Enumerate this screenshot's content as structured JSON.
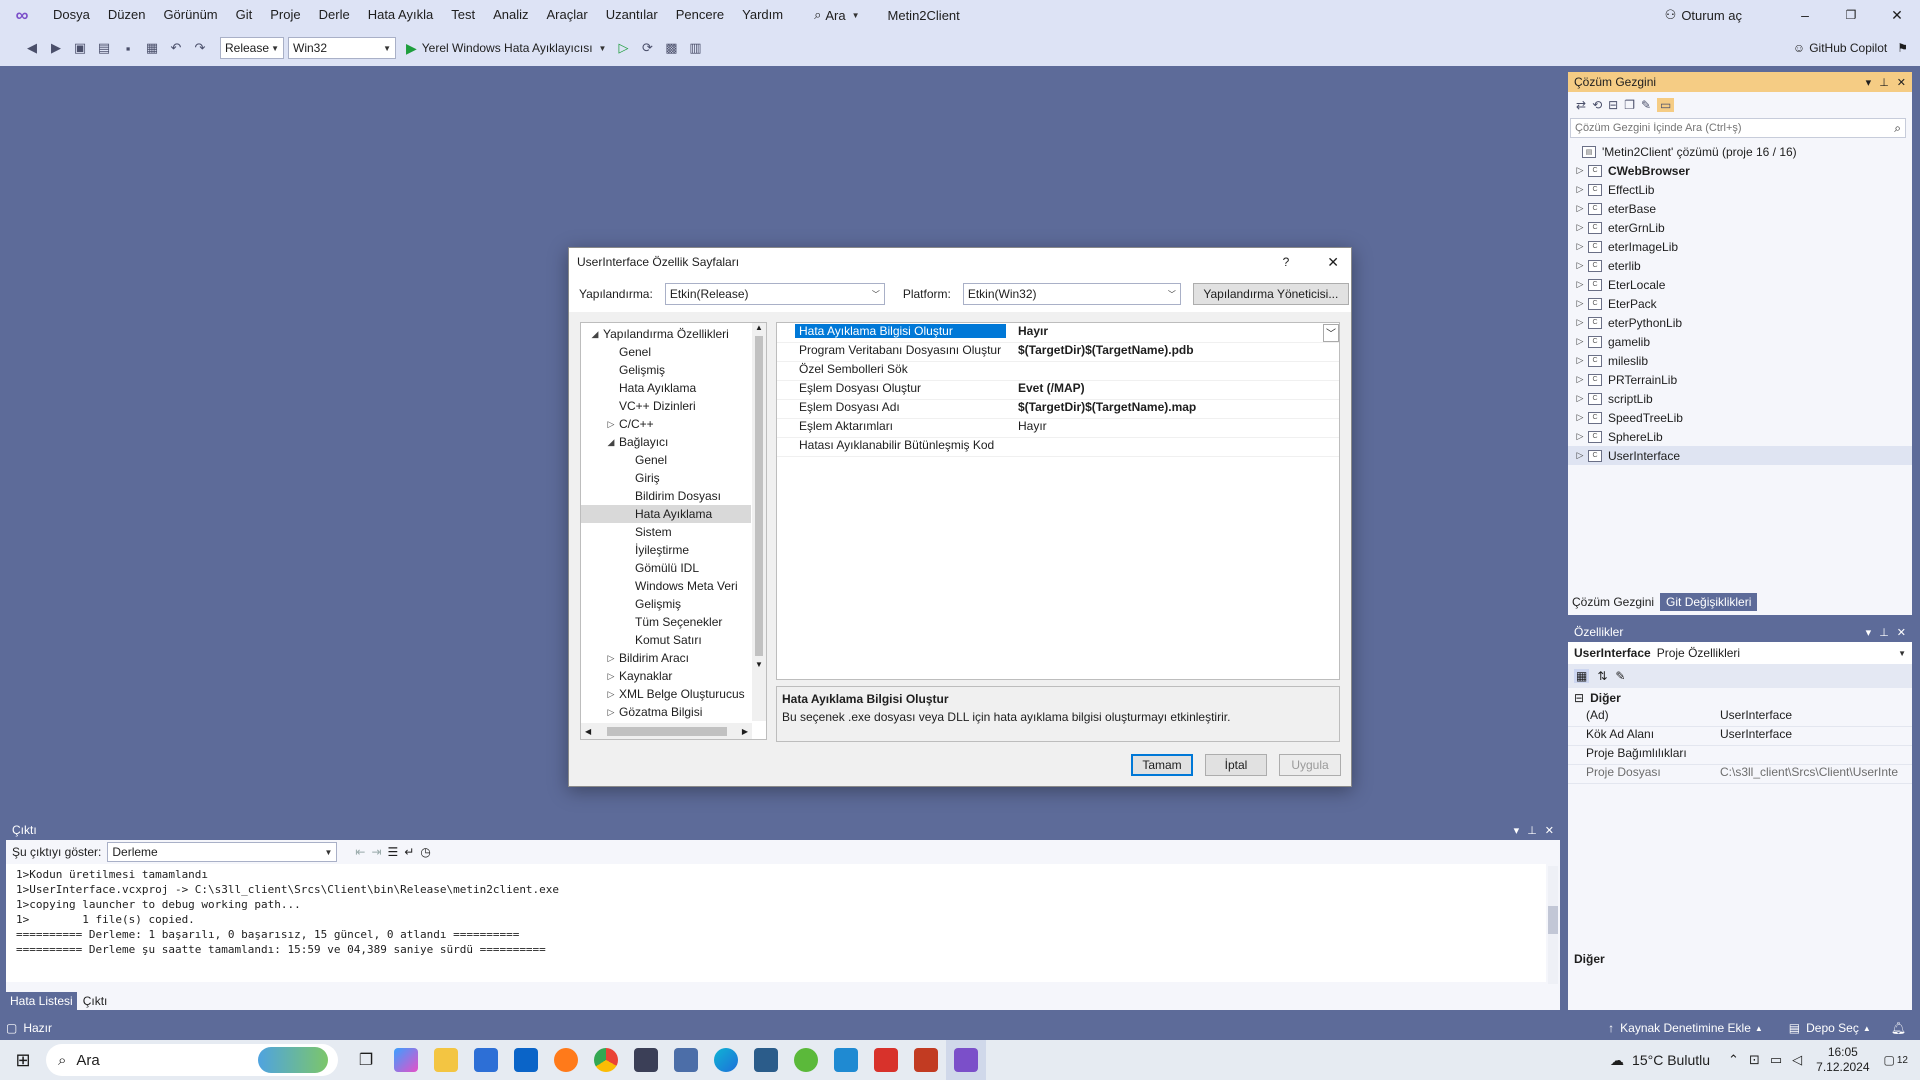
{
  "menu": {
    "items": [
      "Dosya",
      "Düzen",
      "Görünüm",
      "Git",
      "Proje",
      "Derle",
      "Hata Ayıkla",
      "Test",
      "Analiz",
      "Araçlar",
      "Uzantılar",
      "Pencere",
      "Yardım"
    ],
    "search": "Ara",
    "solution_name": "Metin2Client",
    "signin": "Oturum aç"
  },
  "toolbar": {
    "config": "Release",
    "platform": "Win32",
    "debug_label": "Yerel Windows Hata Ayıklayıcısı",
    "copilot": "GitHub Copilot"
  },
  "solution": {
    "title": "Çözüm Gezgini",
    "search_placeholder": "Çözüm Gezgini İçinde Ara (Ctrl+ş)",
    "root": "'Metin2Client' çözümü (proje 16 / 16)",
    "projects": [
      "CWebBrowser",
      "EffectLib",
      "eterBase",
      "eterGrnLib",
      "eterImageLib",
      "eterlib",
      "EterLocale",
      "EterPack",
      "eterPythonLib",
      "gamelib",
      "mileslib",
      "PRTerrainLib",
      "scriptLib",
      "SpeedTreeLib",
      "SphereLib",
      "UserInterface"
    ],
    "tab1": "Çözüm Gezgini",
    "tab2": "Git Değişiklikleri"
  },
  "properties": {
    "title": "Özellikler",
    "object": "UserInterface",
    "object_type": "Proje Özellikleri",
    "category": "Diğer",
    "rows": [
      {
        "k": "(Ad)",
        "v": "UserInterface"
      },
      {
        "k": "Kök Ad Alanı",
        "v": "UserInterface"
      },
      {
        "k": "Proje Bağımlılıkları",
        "v": ""
      },
      {
        "k": "Proje Dosyası",
        "v": "C:\\s3ll_client\\Srcs\\Client\\UserInte"
      }
    ],
    "footer": "Diğer"
  },
  "output": {
    "title": "Çıktı",
    "show_label": "Şu çıktıyı göster:",
    "source": "Derleme",
    "lines": [
      "1>Kodun üretilmesi tamamlandı",
      "1>UserInterface.vcxproj -> C:\\s3ll_client\\Srcs\\Client\\bin\\Release\\metin2client.exe",
      "1>copying launcher to debug working path...",
      "1>        1 file(s) copied.",
      "========== Derleme: 1 başarılı, 0 başarısız, 15 güncel, 0 atlandı ==========",
      "========== Derleme şu saatte tamamlandı: 15:59 ve 04,389 saniye sürdü =========="
    ],
    "tab1": "Hata Listesi",
    "tab2": "Çıktı"
  },
  "dialog": {
    "title": "UserInterface Özellik Sayfaları",
    "help": "?",
    "config_label": "Yapılandırma:",
    "config_value": "Etkin(Release)",
    "platform_label": "Platform:",
    "platform_value": "Etkin(Win32)",
    "manager_btn": "Yapılandırma Yöneticisi...",
    "tree": [
      {
        "t": "Yapılandırma Özellikleri",
        "lvl": 0,
        "exp": "◢"
      },
      {
        "t": "Genel",
        "lvl": 1,
        "exp": ""
      },
      {
        "t": "Gelişmiş",
        "lvl": 1,
        "exp": ""
      },
      {
        "t": "Hata Ayıklama",
        "lvl": 1,
        "exp": ""
      },
      {
        "t": "VC++ Dizinleri",
        "lvl": 1,
        "exp": ""
      },
      {
        "t": "C/C++",
        "lvl": 1,
        "exp": "▷"
      },
      {
        "t": "Bağlayıcı",
        "lvl": 1,
        "exp": "◢"
      },
      {
        "t": "Genel",
        "lvl": 2,
        "exp": ""
      },
      {
        "t": "Giriş",
        "lvl": 2,
        "exp": ""
      },
      {
        "t": "Bildirim Dosyası",
        "lvl": 2,
        "exp": ""
      },
      {
        "t": "Hata Ayıklama",
        "lvl": 2,
        "exp": "",
        "sel": true
      },
      {
        "t": "Sistem",
        "lvl": 2,
        "exp": ""
      },
      {
        "t": "İyileştirme",
        "lvl": 2,
        "exp": ""
      },
      {
        "t": "Gömülü IDL",
        "lvl": 2,
        "exp": ""
      },
      {
        "t": "Windows Meta Veri",
        "lvl": 2,
        "exp": ""
      },
      {
        "t": "Gelişmiş",
        "lvl": 2,
        "exp": ""
      },
      {
        "t": "Tüm Seçenekler",
        "lvl": 2,
        "exp": ""
      },
      {
        "t": "Komut Satırı",
        "lvl": 2,
        "exp": ""
      },
      {
        "t": "Bildirim Aracı",
        "lvl": 1,
        "exp": "▷"
      },
      {
        "t": "Kaynaklar",
        "lvl": 1,
        "exp": "▷"
      },
      {
        "t": "XML Belge Oluşturucus",
        "lvl": 1,
        "exp": "▷"
      },
      {
        "t": "Gözatma Bilgisi",
        "lvl": 1,
        "exp": "▷"
      }
    ],
    "grid": [
      {
        "k": "Hata Ayıklama Bilgisi Oluştur",
        "v": "Hayır",
        "bold": true,
        "sel": true
      },
      {
        "k": "Program Veritabanı Dosyasını Oluştur",
        "v": "$(TargetDir)$(TargetName).pdb",
        "bold": true
      },
      {
        "k": "Özel Sembolleri Sök",
        "v": "",
        "bold": false
      },
      {
        "k": "Eşlem Dosyası Oluştur",
        "v": "Evet (/MAP)",
        "bold": true
      },
      {
        "k": "Eşlem Dosyası Adı",
        "v": "$(TargetDir)$(TargetName).map",
        "bold": true
      },
      {
        "k": "Eşlem Aktarımları",
        "v": "Hayır",
        "bold": false
      },
      {
        "k": "Hatası Ayıklanabilir Bütünleşmiş Kod",
        "v": "",
        "bold": false
      }
    ],
    "desc_title": "Hata Ayıklama Bilgisi Oluştur",
    "desc_text": "Bu seçenek .exe dosyası veya DLL için hata ayıklama bilgisi oluşturmayı etkinleştirir.",
    "ok": "Tamam",
    "cancel": "İptal",
    "apply": "Uygula"
  },
  "status": {
    "ready": "Hazır",
    "source_control": "Kaynak Denetimine Ekle",
    "repo": "Depo Seç"
  },
  "taskbar": {
    "search": "Ara",
    "weather": "15°C  Bulutlu",
    "time": "16:05",
    "date": "7.12.2024",
    "notif": "12"
  },
  "colors": {
    "accent": "#5d6b99",
    "selection": "#0078d7",
    "active_tab": "#f5cc84",
    "vs_purple": "#7b4fc9"
  }
}
